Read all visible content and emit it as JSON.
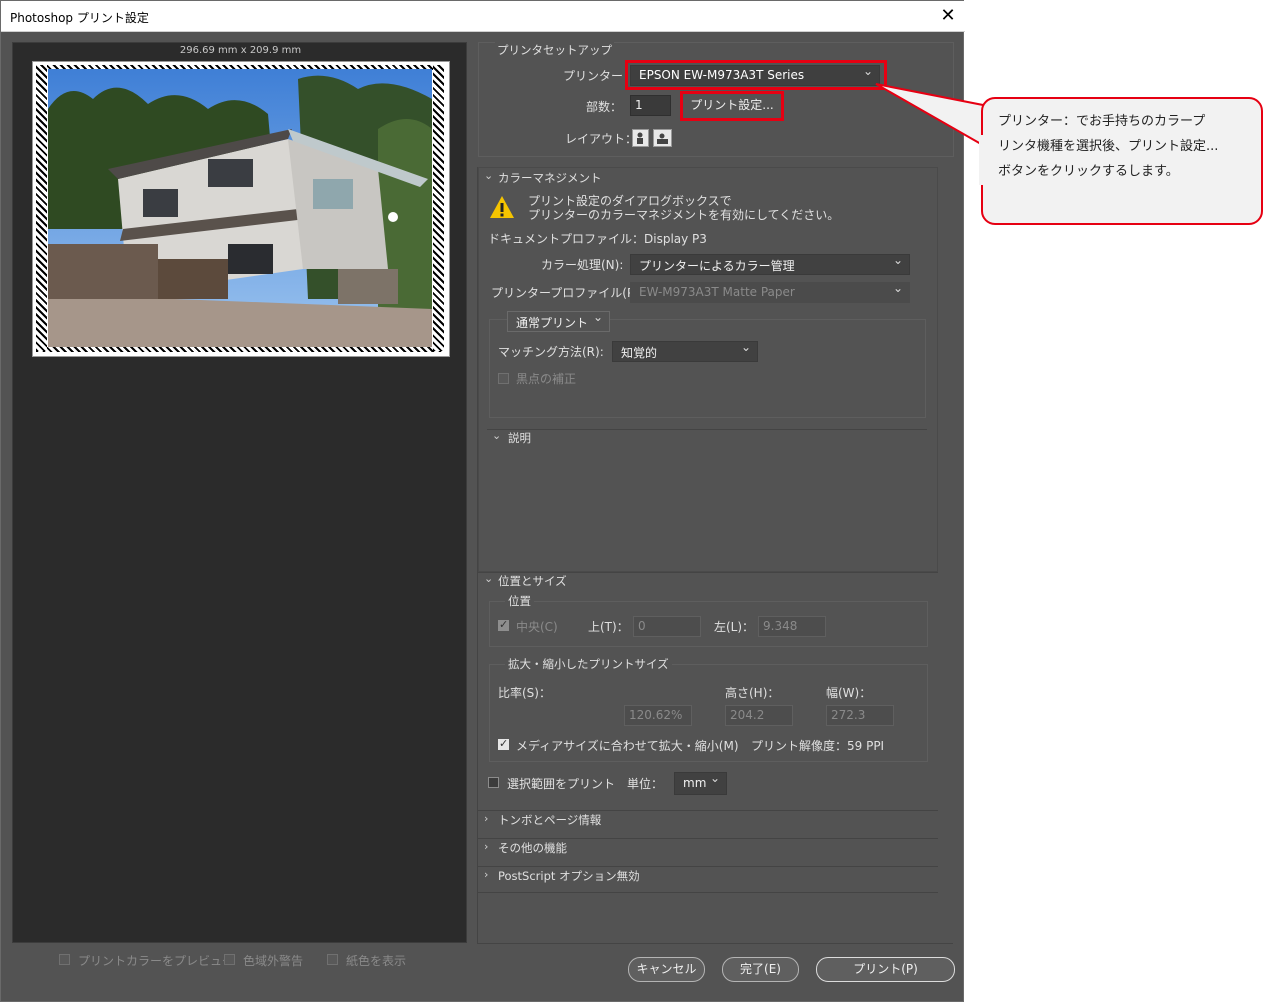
{
  "window": {
    "title": "Photoshop プリント設定",
    "close_glyph": "✕"
  },
  "preview": {
    "size_label": "296.69 mm x 209.9 mm",
    "options": [
      {
        "label": "プリントカラーをプレビュー"
      },
      {
        "label": "色域外警告"
      },
      {
        "label": "紙色を表示"
      }
    ]
  },
  "printer_setup": {
    "group_title": "プリンタセットアップ",
    "printer_label": "プリンター：",
    "printer_value": "EPSON EW-M973A3T Series",
    "copies_label": "部数：",
    "copies_value": "1",
    "print_settings_button": "プリント設定...",
    "layout_label": "レイアウト："
  },
  "color_management": {
    "section_title": "カラーマネジメント",
    "warning_line1": "プリント設定のダイアログボックスで",
    "warning_line2": "プリンターのカラーマネジメントを有効にしてください。",
    "doc_profile": "ドキュメントプロファイル：Display P3",
    "color_handling_label": "カラー処理(N):",
    "color_handling_value": "プリンターによるカラー管理",
    "printer_profile_label": "プリンタープロファイル(P):",
    "printer_profile_value": "EW-M973A3T Matte Paper",
    "print_mode_value": "通常プリント",
    "matching_label": "マッチング方法(R):",
    "matching_value": "知覚的",
    "black_point_label": "黒点の補正"
  },
  "description": {
    "section_title": "説明"
  },
  "position_size": {
    "section_title": "位置とサイズ",
    "position_group": "位置",
    "center_label": "中央(C)",
    "top_label": "上(T)：",
    "top_value": "0",
    "left_label": "左(L)：",
    "left_value": "9.348",
    "scaled_group": "拡大・縮小したプリントサイズ",
    "scale_label": "比率(S)：",
    "scale_value": "120.62%",
    "height_label": "高さ(H)：",
    "height_value": "204.2",
    "width_label": "幅(W)：",
    "width_value": "272.3",
    "fit_media_label": "メディアサイズに合わせて拡大・縮小(M)",
    "resolution_label": "プリント解像度：59 PPI",
    "print_selection_label": "選択範囲をプリント",
    "unit_label": "単位：",
    "unit_value": "mm"
  },
  "collapsed_sections": [
    {
      "label": "トンボとページ情報"
    },
    {
      "label": "その他の機能"
    },
    {
      "label": "PostScript オプション無効"
    }
  ],
  "buttons": {
    "cancel": "キャンセル",
    "done": "完了(E)",
    "print": "プリント(P)"
  },
  "callout": {
    "line1": "プリンター：でお手持ちのカラープ",
    "line2": "リンタ機種を選択後、プリント設定...",
    "line3": "ボタンをクリックするします。"
  },
  "colors": {
    "annotation_red": "#e60012",
    "dialog_bg": "#535353",
    "preview_bg": "#2b2b2b"
  }
}
